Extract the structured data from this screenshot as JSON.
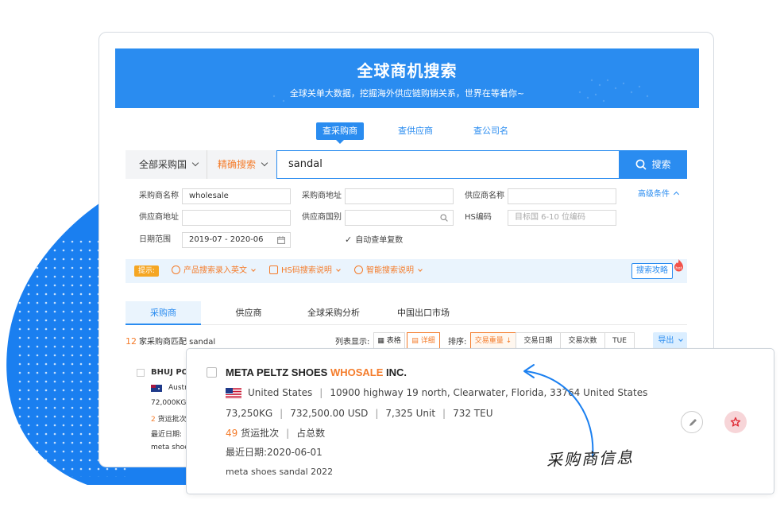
{
  "hero": {
    "title": "全球商机搜索",
    "subtitle": "全球关单大数据，挖掘海外供应链购销关系，世界在等着你~"
  },
  "type_tabs": [
    {
      "label": "查采购商",
      "active": true
    },
    {
      "label": "查供应商",
      "active": false
    },
    {
      "label": "查公司名",
      "active": false
    }
  ],
  "search": {
    "country_select": "全部采购国",
    "mode_select": "精确搜索",
    "query": "sandal",
    "button_label": "搜索"
  },
  "filters": {
    "buyer_name_label": "采购商名称",
    "buyer_name_value": "wholesale",
    "buyer_address_label": "采购商地址",
    "supplier_name_label": "供应商名称",
    "supplier_address_label": "供应商地址",
    "supplier_country_label": "供应商国别",
    "hs_code_label": "HS编码",
    "hs_code_placeholder": "目标国 6-10 位编码",
    "date_range_label": "日期范围",
    "date_range_value": "2019-07 - 2020-06",
    "auto_dedupe_label": "自动查单复数",
    "advanced_label": "高级条件"
  },
  "hint_bar": {
    "label": "提示:",
    "items": [
      "产品搜索录入英文",
      "HS码搜索说明",
      "智能搜索说明"
    ],
    "guide_button": "搜索攻略"
  },
  "result_tabs": [
    {
      "label": "采购商",
      "active": true
    },
    {
      "label": "供应商",
      "active": false
    },
    {
      "label": "全球采购分析",
      "active": false
    },
    {
      "label": "中国出口市场",
      "active": false
    }
  ],
  "results_toolbar": {
    "count": "12",
    "count_text": "家采购商匹配 sandal",
    "list_display_label": "列表显示:",
    "view_table": "表格",
    "view_detail": "详细",
    "sort_label": "排序:",
    "sort_options": [
      "交易重量 ↓",
      "交易日期",
      "交易次数",
      "TUE"
    ],
    "export_label": "导出"
  },
  "background_result": {
    "name": "BHUJ PO",
    "country": "Austr",
    "weight": "72,000KG",
    "shipments_num": "2",
    "shipments_text": "货运批次",
    "last_date_label": "最近日期:",
    "product": "meta shoes"
  },
  "detail_result": {
    "name_prefix": "META PELTZ SHOES ",
    "name_highlight": "WHOSALE",
    "name_suffix": " INC.",
    "country": "United States",
    "address": "10900 highway 19 north, Clearwater, Florida, 33764 United States",
    "weight": "73,250KG",
    "value": "732,500.00 USD",
    "units": "7,325 Unit",
    "teu": "732 TEU",
    "shipments_num": "49",
    "shipments_text": "货运批次",
    "share_text": "占总数",
    "last_date_label": "最近日期:",
    "last_date": "2020-06-01",
    "product": "meta shoes sandal 2022"
  },
  "annotation": {
    "text": "采购商信息"
  },
  "colors": {
    "primary": "#2a8cf0",
    "accent": "#f47c2b",
    "blob": "#1a7ff0"
  }
}
